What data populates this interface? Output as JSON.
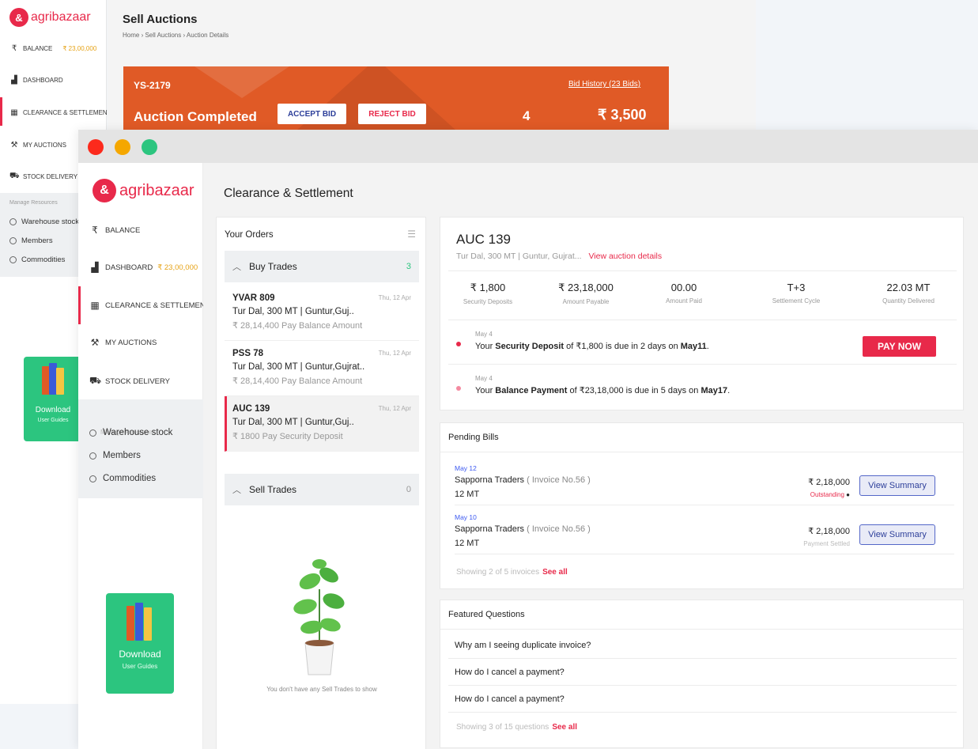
{
  "back": {
    "logo": "agribazaar",
    "balance_label": "BALANCE",
    "balance_value": "₹ 23,00,000",
    "nav": [
      "DASHBOARD",
      "CLEARANCE & SETTLEMENT",
      "MY AUCTIONS",
      "STOCK DELIVERY"
    ],
    "resources_heading": "Manage Resources",
    "resources": [
      "Warehouse stock",
      "Members",
      "Commodities"
    ],
    "download_title": "Download",
    "download_sub": "User Guides",
    "page_title": "Sell Auctions",
    "breadcrumb": "Home › Sell Auctions  › Auction Details",
    "banner": {
      "code": "YS-2179",
      "bid_history": "Bid History (23 Bids)",
      "status": "Auction Completed",
      "accept": "ACCEPT BID",
      "reject": "REJECT BID",
      "count": "4",
      "amount": "₹ 3,500",
      "colors": {
        "banner": "#e05a26",
        "accept_text": "#2d3f9a",
        "reject_text": "#e8294a"
      }
    }
  },
  "front": {
    "logo": "agribazaar",
    "sidebar": {
      "balance_label": "BALANCE",
      "dashboard_label": "DASHBOARD",
      "dashboard_value": "₹ 23,00,000",
      "clearance": "CLEARANCE & SETTLEMENT",
      "auctions": "MY AUCTIONS",
      "delivery": "STOCK DELIVERY",
      "resources_heading": "Manage Resources",
      "resources": [
        "Warehouse stock",
        "Members",
        "Commodities"
      ],
      "download_title": "Download",
      "download_sub": "User Guides"
    },
    "page_title": "Clearance & Settlement",
    "orders": {
      "header": "Your Orders",
      "buy_label": "Buy Trades",
      "buy_count": "3",
      "items": [
        {
          "code": "YVAR 809",
          "date": "Thu, 12 Apr",
          "desc": "Tur Dal, 300 MT | Guntur,Guj..",
          "balance": "₹ 28,14,400 Pay Balance Amount"
        },
        {
          "code": "PSS 78",
          "date": "Thu, 12 Apr",
          "desc": "Tur Dal, 300 MT | Guntur,Gujrat..",
          "balance": "₹ 28,14,400 Pay Balance Amount"
        },
        {
          "code": "AUC 139",
          "date": "Thu, 12 Apr",
          "desc": "Tur Dal, 300 MT | Guntur,Guj..",
          "balance": "₹ 1800 Pay Security Deposit"
        }
      ],
      "sell_label": "Sell Trades",
      "sell_count": "0",
      "empty_message": "You don't have any Sell Trades to show"
    },
    "auction": {
      "title": "AUC 139",
      "subtitle": "Tur Dal, 300 MT | Guntur, Gujrat...",
      "details_link": "View auction details",
      "stats": [
        {
          "value": "₹ 1,800",
          "label": "Security Deposits"
        },
        {
          "value": "₹ 23,18,000",
          "label": "Amount Payable"
        },
        {
          "value": "00.00",
          "label": "Amount Paid"
        },
        {
          "value": "T+3",
          "label": "Settlement Cycle"
        },
        {
          "value": "22.03 MT",
          "label": "Quantity Delivered"
        }
      ],
      "alerts": [
        {
          "date": "May 4",
          "pre": "Your ",
          "bold1": "Security Deposit",
          "mid": " of ₹1,800 is due in 2 days on ",
          "bold2": "May11",
          "end": "."
        },
        {
          "date": "May 4",
          "pre": "Your ",
          "bold1": "Balance Payment",
          "mid": " of ₹23,18,000 is due in 5 days on ",
          "bold2": "May17",
          "end": "."
        }
      ],
      "pay_now": "PAY NOW"
    },
    "bills": {
      "header": "Pending Bills",
      "items": [
        {
          "date": "May 12",
          "name": "Sapporna Traders",
          "invoice": "( Invoice No.56 )",
          "qty": "12 MT",
          "amount": "₹ 2,18,000",
          "status": "Outstanding",
          "button": "View Summary"
        },
        {
          "date": "May 10",
          "name": "Sapporna Traders",
          "invoice": "( Invoice No.56 )",
          "qty": "12 MT",
          "amount": "₹ 2,18,000",
          "status": "Payment Settled",
          "button": "View Summary"
        }
      ],
      "showing": "Showing 2 of 5 invoices",
      "see_all": "See all"
    },
    "faq": {
      "header": "Featured Questions",
      "items": [
        "Why am I seeing duplicate invoice?",
        "How do I cancel a payment?",
        "How do I cancel a payment?"
      ],
      "showing": "Showing 3 of 15 questions",
      "see_all": "See all"
    }
  },
  "colors": {
    "brand": "#e8294a",
    "gold": "#e6a317",
    "green": "#2cc57f",
    "outstanding": "#e8294a",
    "settled": "#bbbbbb"
  }
}
